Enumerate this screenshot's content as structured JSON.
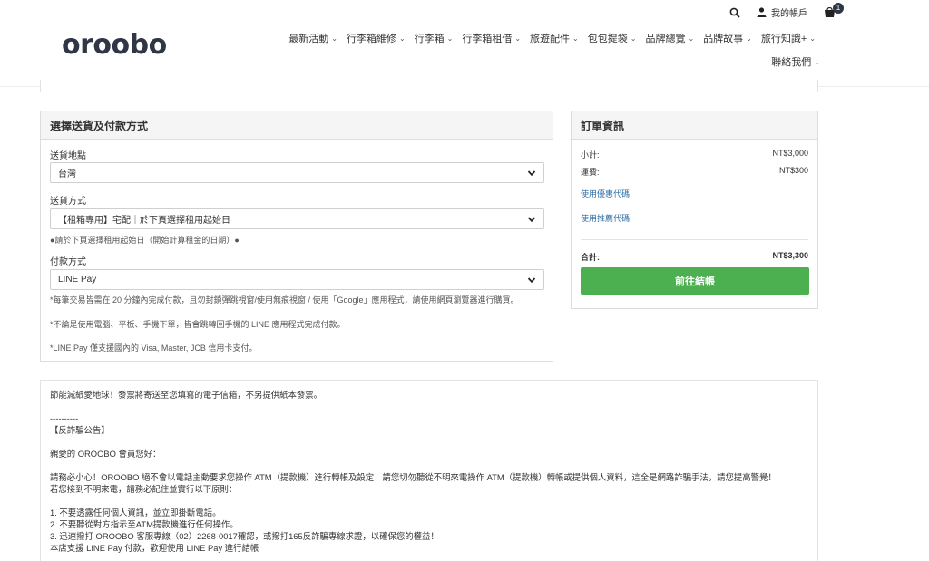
{
  "header": {
    "logo": "oroobo",
    "account_label": "我的帳戶",
    "cart_count": "1",
    "nav": [
      {
        "label": "最新活動"
      },
      {
        "label": "行李箱維修"
      },
      {
        "label": "行李箱"
      },
      {
        "label": "行李箱租借"
      },
      {
        "label": "旅遊配件"
      },
      {
        "label": "包包提袋"
      },
      {
        "label": "品牌總覽"
      },
      {
        "label": "品牌故事"
      },
      {
        "label": "旅行知識+"
      }
    ],
    "nav_second": "聯絡我們"
  },
  "shipping": {
    "title": "選擇送貨及付款方式",
    "location_label": "送貨地點",
    "location_value": "台灣",
    "method_label": "送貨方式",
    "method_value": "【租箱專用】宅配｜於下頁選擇租用起始日",
    "method_note": "●請於下頁選擇租用起始日（開始計算租金的日期）●",
    "payment_label": "付款方式",
    "payment_value": "LINE Pay",
    "payment_notes": [
      "*每筆交易皆需在 20 分鐘內完成付款，且勿封鎖彈跳視窗/使用無痕視窗 / 使用「Google」應用程式，請使用網頁瀏覽器進行購買。",
      "*不論是使用電腦、平板、手機下單，皆會跳轉回手機的 LINE 應用程式完成付款。",
      "*LINE Pay 僅支援國內的 Visa, Master, JCB 信用卡支付。"
    ]
  },
  "order": {
    "title": "訂單資訊",
    "subtotal_label": "小計:",
    "subtotal_value": "NT$3,000",
    "shipping_label": "運費:",
    "shipping_value": "NT$300",
    "coupon_link": "使用優惠代碼",
    "referral_link": "使用推薦代碼",
    "total_label": "合計:",
    "total_value": "NT$3,300",
    "checkout_label": "前往結帳"
  },
  "notice": {
    "line1": "節能減紙愛地球！發票將寄送至您填寫的電子信箱，不另提供紙本發票。",
    "line2": "----------",
    "line3": "【反詐騙公告】",
    "line4": "親愛的 OROOBO 會員您好：",
    "line5": "請務必小心！OROOBO 絕不會以電話主動要求您操作 ATM（提款機）進行轉帳及設定！請您切勿聽從不明來電操作 ATM（提款機）轉帳或提供個人資料，這全是網路詐騙手法，請您提高警覺！",
    "line6": "若您接到不明來電，請務必記住並實行以下原則：",
    "line7": "1. 不要透露任何個人資訊，並立即掛斷電話。",
    "line8": "2. 不要聽從對方指示至ATM提款機進行任何操作。",
    "line9": "3. 迅速撥打 OROOBO 客服專線（02）2268-0017確認，或撥打165反詐騙專線求證，以確保您的權益！",
    "line10": "本店支援 LINE Pay 付款，歡迎使用 LINE Pay 進行結帳"
  },
  "colors": {
    "accent": "#4caf50",
    "link": "#2f6ea5",
    "logo": "#2f3645"
  }
}
